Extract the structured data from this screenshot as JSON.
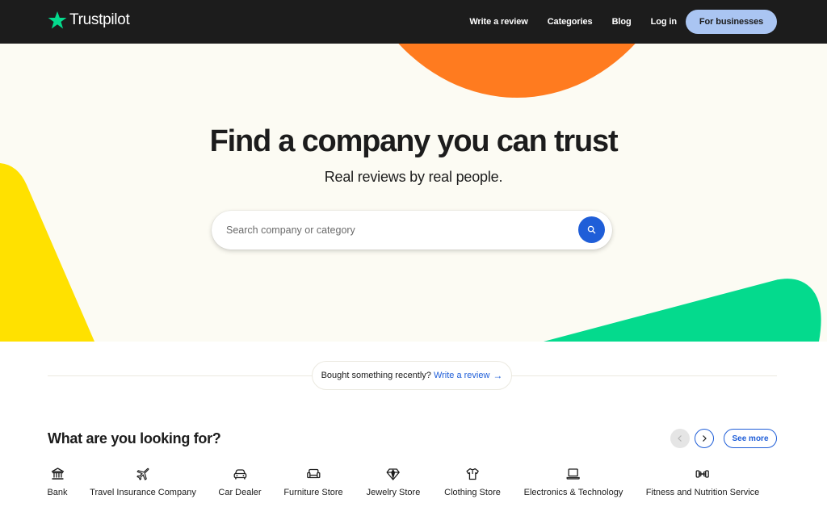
{
  "header": {
    "brand": "Trustpilot",
    "nav": {
      "write_review": "Write a review",
      "categories": "Categories",
      "blog": "Blog",
      "login": "Log in",
      "for_businesses": "For businesses"
    },
    "colors": {
      "bar": "#1c1c1c",
      "business_button": "#aac5f2",
      "logo_star": "#04da8d"
    }
  },
  "hero": {
    "title": "Find a company you can trust",
    "subtitle": "Real reviews by real people.",
    "search": {
      "placeholder": "Search company or category",
      "value": "",
      "button_icon": "search-icon"
    },
    "colors": {
      "background": "#fcfbf3",
      "orange": "#ff7b1f",
      "yellow": "#ffe100",
      "green": "#04da8d",
      "accent_blue": "#1f5ed8"
    }
  },
  "prompt": {
    "text": "Bought something recently?",
    "link": "Write a review",
    "link_icon": "arrow-right-icon"
  },
  "categories_section": {
    "title": "What are you looking for?",
    "prev_icon": "chevron-left-icon",
    "next_icon": "chevron-right-icon",
    "see_more": "See more",
    "items": [
      {
        "label": "Bank",
        "icon": "bank-icon"
      },
      {
        "label": "Travel Insurance Company",
        "icon": "airplane-icon"
      },
      {
        "label": "Car Dealer",
        "icon": "car-icon"
      },
      {
        "label": "Furniture Store",
        "icon": "sofa-icon"
      },
      {
        "label": "Jewelry Store",
        "icon": "diamond-icon"
      },
      {
        "label": "Clothing Store",
        "icon": "shirt-icon"
      },
      {
        "label": "Electronics & Technology",
        "icon": "laptop-icon"
      },
      {
        "label": "Fitness and Nutrition Service",
        "icon": "dumbbell-icon"
      }
    ]
  }
}
